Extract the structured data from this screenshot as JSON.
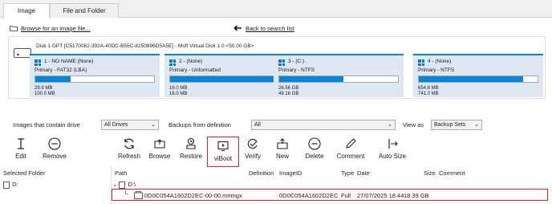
{
  "tabs": [
    {
      "label": "Image",
      "active": true
    },
    {
      "label": "File and Folder",
      "active": false
    }
  ],
  "links": {
    "browse": "Browse for an image file...",
    "back": "Back to search list"
  },
  "disk": {
    "info": "Disk 1 GPT [C5170082-392A-40DC-B55C-8250896D5A5E] - Msft   Virtual Disk   1.0  <50.00 GB>",
    "partitions": [
      {
        "name": "1 - NO NAME (None)",
        "type": "Primary - FAT32 (LBA)",
        "used": "29.9 MB",
        "total": "100.0 MB",
        "fill": 0.3
      },
      {
        "name": "2 -  (None)",
        "type": "Primary - Unformatted",
        "used": "16.0 MB",
        "total": "16.0 MB",
        "fill": 1.0
      },
      {
        "name": "3 - (C:)",
        "type": "Primary - NTFS",
        "used": "26.56 GB",
        "total": "49.16 GB",
        "fill": 0.54
      },
      {
        "name": "4 -  (None)",
        "type": "Primary - NTFS",
        "used": "654.8 MB",
        "total": "741.0 MB",
        "fill": 0.88
      }
    ]
  },
  "filters": {
    "drive_label": "Images that contain drive",
    "drive_value": "All Drives",
    "def_label": "Backups from definition",
    "def_value": "All",
    "view_label": "View as",
    "view_value": "Backup Sets"
  },
  "toolbar": {
    "edit": "Edit",
    "remove": "Remove",
    "refresh": "Refresh",
    "browse": "Browse",
    "restore": "Restore",
    "viboot": "viBoot",
    "verify": "Verify",
    "new": "New",
    "delete": "Delete",
    "comment": "Comment",
    "autosize": "Auto Size"
  },
  "columns": {
    "selected_folder": "Selected Folder",
    "path": "Path",
    "definition": "Definition",
    "imageid": "ImageID",
    "type": "Type",
    "date": "Date",
    "size": "Size",
    "comment": "Comment"
  },
  "folder": "D:",
  "tree_root": "D:\\",
  "backup": {
    "file": "0D0C054A1602D2EC-00-00.mrimgx",
    "imageid": "0D0C054A1602D2EC",
    "type": "Full",
    "date": "27/07/2025 18:44",
    "size": "18.39 GB"
  },
  "colors": {
    "accent": "#0a84d8",
    "highlight": "#e0212a",
    "partition_bg": "#dfe7f3"
  }
}
